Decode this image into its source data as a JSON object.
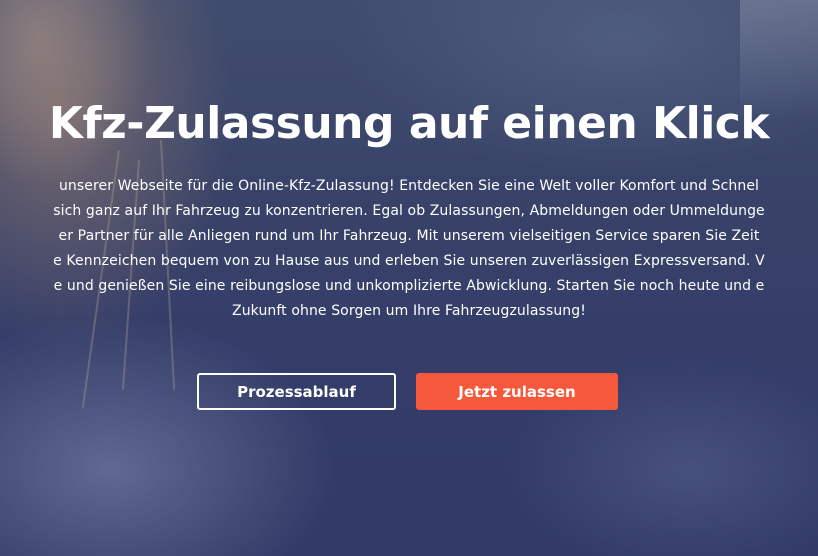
{
  "hero": {
    "title": "Kfz-Zulassung auf einen Klick",
    "intro_lines": [
      "unserer Webseite für die Online-Kfz-Zulassung! Entdecken Sie eine Welt voller Komfort und Schnel",
      "sich ganz auf Ihr Fahrzeug zu konzentrieren. Egal ob Zulassungen, Abmeldungen oder Ummeldunge",
      "er Partner für alle Anliegen rund um Ihr Fahrzeug. Mit unserem vielseitigen Service sparen Sie Zeit",
      "e Kennzeichen bequem von zu Hause aus und erleben Sie unseren zuverlässigen Expressversand. V",
      "e und genießen Sie eine reibungslose und unkomplizierte Abwicklung. Starten Sie noch heute und e",
      "Zukunft ohne Sorgen um Ihre Fahrzeugzulassung!"
    ],
    "buttons": {
      "secondary_label": "Prozessablauf",
      "primary_label": "Jetzt zulassen"
    }
  },
  "colors": {
    "primary_button": "#f5583a",
    "text": "#ffffff",
    "overlay": "#3a4470"
  }
}
